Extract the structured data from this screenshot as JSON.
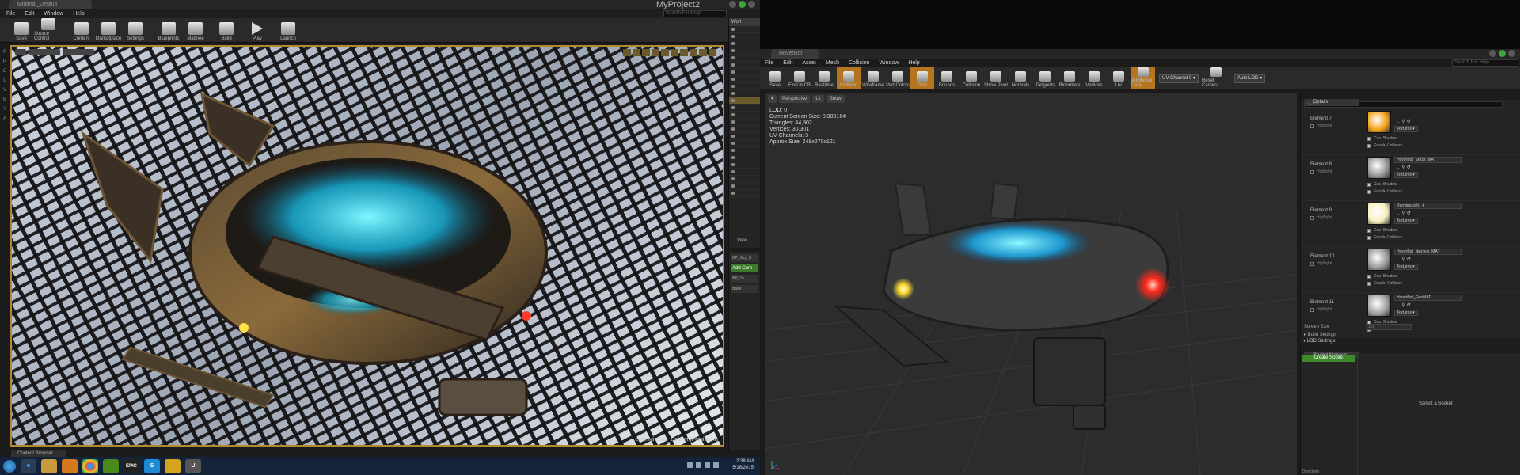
{
  "left_editor": {
    "title_tab": "Minimal_Default",
    "project": "MyProject2",
    "menu": [
      "File",
      "Edit",
      "Window",
      "Help"
    ],
    "search_placeholder": "Search For Help",
    "toolbar": [
      "Save",
      "Source Control",
      "Content",
      "Marketplace",
      "Settings",
      "Blueprints",
      "Matinee",
      "Build",
      "Play",
      "Launch"
    ],
    "mode_strip": [
      "P",
      "R",
      "G",
      "L",
      "V",
      "B",
      "Y",
      "A"
    ],
    "level_label": "Level:  Minimal_Default (Persistent)",
    "outliner_header": "Worl",
    "outliner_rows": [
      "",
      "",
      "",
      "",
      "",
      "",
      "",
      "",
      "",
      "",
      "",
      "",
      "",
      "",
      "",
      "",
      "",
      "",
      "",
      "",
      "",
      "",
      "",
      ""
    ],
    "outliner_view": "View",
    "details_items": [
      "BP_Sky_S",
      "Add Com",
      "BP_Sk",
      "Base"
    ],
    "content_browser_tab": "Content Browser"
  },
  "taskbar": {
    "apps": [
      "e",
      "",
      "",
      "",
      "",
      "EPIC",
      "S",
      "",
      "U"
    ],
    "time": "2:38 AM",
    "date": "5/16/2015"
  },
  "mesh_editor": {
    "title_tab": "HoverBot",
    "menu": [
      "File",
      "Edit",
      "Asset",
      "Mesh",
      "Collision",
      "Window",
      "Help"
    ],
    "search_placeholder": "Search For Help",
    "toolbar": [
      {
        "label": "Save",
        "on": false
      },
      {
        "label": "Find in CB",
        "on": false
      },
      {
        "label": "Realtime",
        "on": false
      },
      {
        "label": "Collision",
        "on": true
      },
      {
        "label": "Wireframe",
        "on": false
      },
      {
        "label": "Vert Colors",
        "on": false
      },
      {
        "label": "Grid",
        "on": true
      },
      {
        "label": "Bounds",
        "on": false
      },
      {
        "label": "Collision",
        "on": false
      },
      {
        "label": "Show Pivot",
        "on": false
      },
      {
        "label": "Normals",
        "on": false
      },
      {
        "label": "Tangents",
        "on": false
      },
      {
        "label": "Binormals",
        "on": false
      },
      {
        "label": "Vertices",
        "on": false
      },
      {
        "label": "UV",
        "on": false
      },
      {
        "label": "Additional Data",
        "on": true
      }
    ],
    "uv_channel": "UV Channel 0 ▾",
    "reset_camera": "Reset Camera",
    "auto_lod": "Auto LOD ▾",
    "viewport_bar": [
      "▾",
      "Perspective",
      "Lit",
      "Show"
    ],
    "stats": [
      "LOD:  0",
      "Current Screen Size:  0.900164",
      "Triangles:  44,902",
      "Vertices:  30,301",
      "UV Channels:  3",
      "Approx Size: 248x270x121"
    ],
    "details_tab": "Details",
    "details_search": "Search",
    "elements": [
      {
        "name": "Element 7",
        "material": "",
        "thumb": "#f5a41a"
      },
      {
        "name": "Element 8",
        "material": "HoverBot_Struts_MAT",
        "thumb": "#9a9a9a"
      },
      {
        "name": "Element 9",
        "material": "RunningLight_4",
        "thumb": "#f7f0c0"
      },
      {
        "name": "Element 10",
        "material": "HoverBot_Nozzels_MAT",
        "thumb": "#9c9c9c"
      },
      {
        "name": "Element 11",
        "material": "HoverBot_GunMAT",
        "thumb": "#a5a5a5"
      }
    ],
    "highlight_label": "Highlight",
    "textures_label": "Textures ▾",
    "cast_shadow_label": "Cast Shadow",
    "enable_collision_label": "Enable Collision",
    "screen_size_label": "Screen Size",
    "screen_size_value": "1.0",
    "build_settings": "▸ Build Settings",
    "lod_settings": "▾ LOD Settings",
    "socket_tab": "Socket Manager",
    "create_socket": "Create Socket",
    "socket_count": "0 sockets",
    "select_socket_hint": "Select a Socket"
  }
}
